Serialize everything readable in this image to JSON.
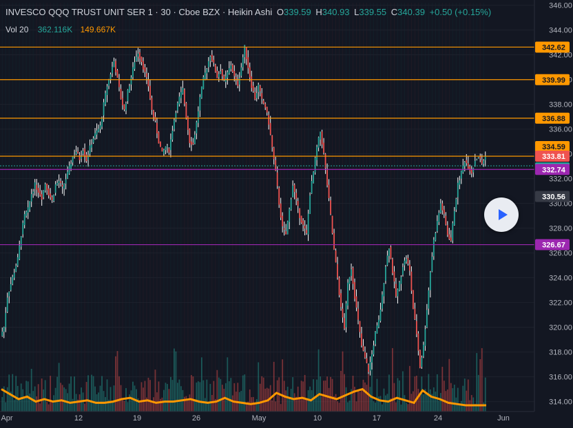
{
  "legend": {
    "symbol": "INVESCO QQQ TRUST UNIT SER 1 · 30 · Cboe BZX · Heikin Ashi",
    "o_label": "O",
    "o_value": "339.59",
    "h_label": "H",
    "h_value": "340.93",
    "l_label": "L",
    "l_value": "339.55",
    "c_label": "C",
    "c_value": "340.39",
    "change": "+0.50 (+0.15%)"
  },
  "volume_legend": {
    "label": "Vol 20",
    "value": "362.116K",
    "ma_value": "149.667K"
  },
  "colors": {
    "background": "#131722",
    "up": "#26a69a",
    "down": "#ef5350",
    "orange_line": "#ff9800",
    "purple_line": "#9c27b0",
    "text": "#d1d4dc"
  },
  "play_button": {
    "icon": "play-icon"
  },
  "chart_data": {
    "type": "candlestick",
    "style": "Heikin Ashi",
    "interval": "30",
    "y_axis": {
      "range": [
        313.2,
        346.2
      ],
      "ticks": [
        "314.00",
        "316.00",
        "318.00",
        "320.00",
        "322.00",
        "324.00",
        "326.00",
        "328.00",
        "330.00",
        "332.00",
        "334.00",
        "336.00",
        "338.00",
        "340.00",
        "342.00",
        "344.00",
        "346.00"
      ]
    },
    "x_axis": {
      "labels": [
        "Apr",
        "12",
        "19",
        "26",
        "May",
        "10",
        "17",
        "24",
        "Jun"
      ]
    },
    "horizontal_lines": [
      {
        "value": 342.62,
        "label": "342.62",
        "color": "#ff9800"
      },
      {
        "value": 339.99,
        "label": "339.99",
        "color": "#ff9800"
      },
      {
        "value": 336.88,
        "label": "336.88",
        "color": "#ff9800"
      },
      {
        "value": 333.81,
        "label": "333.81",
        "color": "#ff9800"
      },
      {
        "value": 332.74,
        "label": "332.74",
        "color": "#9c27b0"
      },
      {
        "value": 326.67,
        "label": "326.67",
        "color": "#9c27b0"
      }
    ],
    "axis_badges": [
      {
        "value": 342.62,
        "label": "342.62",
        "color": "#ff9800"
      },
      {
        "value": 339.99,
        "label": "339.99",
        "color": "#ff9800"
      },
      {
        "value": 336.88,
        "label": "336.88",
        "color": "#ff9800"
      },
      {
        "value": 334.59,
        "label": "334.59",
        "color": "#ff9800"
      },
      {
        "value": 333.81,
        "label": "333.81",
        "color": "#ef5350"
      },
      {
        "value": 333.81,
        "label": "333.81",
        "color": "#26a69a",
        "offset": 1
      },
      {
        "value": 332.74,
        "label": "332.74",
        "color": "#9c27b0"
      },
      {
        "value": 330.56,
        "label": "330.56",
        "color": "#363a45"
      },
      {
        "value": 326.67,
        "label": "326.67",
        "color": "#9c27b0"
      }
    ],
    "last_price": 333.81,
    "price_path": [
      [
        0,
        319.3
      ],
      [
        2,
        320.0
      ],
      [
        4,
        322.5
      ],
      [
        6,
        323.5
      ],
      [
        8,
        324.5
      ],
      [
        10,
        325.5
      ],
      [
        12,
        327.5
      ],
      [
        14,
        329.0
      ],
      [
        16,
        329.5
      ],
      [
        18,
        330.8
      ],
      [
        20,
        331.5
      ],
      [
        22,
        331.0
      ],
      [
        24,
        330.5
      ],
      [
        26,
        331.6
      ],
      [
        28,
        330.8
      ],
      [
        30,
        330.2
      ],
      [
        32,
        331.5
      ],
      [
        34,
        331.8
      ],
      [
        36,
        331.2
      ],
      [
        38,
        332.0
      ],
      [
        40,
        332.8
      ],
      [
        42,
        333.8
      ],
      [
        44,
        334.2
      ],
      [
        46,
        333.6
      ],
      [
        48,
        334.4
      ],
      [
        50,
        333.5
      ],
      [
        52,
        334.5
      ],
      [
        54,
        335.3
      ],
      [
        56,
        335.8
      ],
      [
        58,
        336.2
      ],
      [
        60,
        338.0
      ],
      [
        62,
        339.5
      ],
      [
        64,
        340.5
      ],
      [
        66,
        341.5
      ],
      [
        68,
        340.0
      ],
      [
        70,
        338.5
      ],
      [
        72,
        337.5
      ],
      [
        74,
        339.0
      ],
      [
        76,
        340.2
      ],
      [
        78,
        341.5
      ],
      [
        80,
        342.2
      ],
      [
        82,
        341.5
      ],
      [
        84,
        340.5
      ],
      [
        86,
        339.5
      ],
      [
        88,
        337.5
      ],
      [
        90,
        336.5
      ],
      [
        92,
        335.0
      ],
      [
        94,
        334.0
      ],
      [
        96,
        334.6
      ],
      [
        98,
        334.3
      ],
      [
        100,
        336.0
      ],
      [
        102,
        337.5
      ],
      [
        104,
        338.5
      ],
      [
        106,
        339.2
      ],
      [
        108,
        337.0
      ],
      [
        110,
        335.0
      ],
      [
        112,
        334.8
      ],
      [
        114,
        336.5
      ],
      [
        116,
        338.5
      ],
      [
        118,
        340.0
      ],
      [
        120,
        341.0
      ],
      [
        122,
        342.0
      ],
      [
        124,
        341.2
      ],
      [
        126,
        340.2
      ],
      [
        128,
        340.8
      ],
      [
        130,
        339.8
      ],
      [
        132,
        340.5
      ],
      [
        134,
        341.2
      ],
      [
        136,
        340.2
      ],
      [
        138,
        339.6
      ],
      [
        140,
        341.0
      ],
      [
        142,
        342.6
      ],
      [
        144,
        341.0
      ],
      [
        146,
        339.5
      ],
      [
        148,
        338.5
      ],
      [
        150,
        339.5
      ],
      [
        152,
        338.3
      ],
      [
        154,
        337.8
      ],
      [
        156,
        336.5
      ],
      [
        158,
        334.5
      ],
      [
        160,
        332.5
      ],
      [
        162,
        330.0
      ],
      [
        164,
        328.0
      ],
      [
        166,
        327.5
      ],
      [
        168,
        329.5
      ],
      [
        170,
        331.5
      ],
      [
        172,
        330.2
      ],
      [
        174,
        329.0
      ],
      [
        176,
        328.2
      ],
      [
        178,
        327.5
      ],
      [
        180,
        330.8
      ],
      [
        182,
        332.5
      ],
      [
        184,
        334.5
      ],
      [
        186,
        335.8
      ],
      [
        188,
        334.0
      ],
      [
        190,
        331.5
      ],
      [
        192,
        329.0
      ],
      [
        194,
        326.2
      ],
      [
        196,
        324.0
      ],
      [
        198,
        321.5
      ],
      [
        200,
        320.0
      ],
      [
        202,
        323.5
      ],
      [
        204,
        324.8
      ],
      [
        206,
        322.5
      ],
      [
        208,
        320.5
      ],
      [
        210,
        318.5
      ],
      [
        212,
        317.5
      ],
      [
        214,
        316.5
      ],
      [
        216,
        317.8
      ],
      [
        218,
        319.5
      ],
      [
        220,
        320.5
      ],
      [
        222,
        322.5
      ],
      [
        224,
        325.0
      ],
      [
        226,
        326.5
      ],
      [
        228,
        324.5
      ],
      [
        230,
        322.5
      ],
      [
        232,
        323.5
      ],
      [
        234,
        325.0
      ],
      [
        236,
        325.6
      ],
      [
        238,
        324.5
      ],
      [
        240,
        321.5
      ],
      [
        242,
        319.5
      ],
      [
        244,
        316.8
      ],
      [
        246,
        318.5
      ],
      [
        248,
        321.5
      ],
      [
        250,
        324.5
      ],
      [
        252,
        327.0
      ],
      [
        254,
        328.5
      ],
      [
        256,
        330.0
      ],
      [
        258,
        329.0
      ],
      [
        260,
        327.5
      ],
      [
        262,
        327.0
      ],
      [
        264,
        329.5
      ],
      [
        266,
        331.5
      ],
      [
        268,
        332.5
      ],
      [
        270,
        333.5
      ],
      [
        272,
        333.0
      ],
      [
        274,
        332.5
      ],
      [
        276,
        333.5
      ],
      [
        278,
        333.8
      ],
      [
        280,
        333.2
      ],
      [
        282,
        333.8
      ]
    ],
    "volume_ma": [
      [
        0,
        315.0
      ],
      [
        5,
        314.6
      ],
      [
        10,
        314.2
      ],
      [
        15,
        314.4
      ],
      [
        20,
        314.0
      ],
      [
        25,
        314.2
      ],
      [
        30,
        314.0
      ],
      [
        35,
        314.1
      ],
      [
        40,
        313.9
      ],
      [
        45,
        314.0
      ],
      [
        50,
        314.1
      ],
      [
        55,
        313.9
      ],
      [
        60,
        313.9
      ],
      [
        65,
        314.0
      ],
      [
        70,
        314.2
      ],
      [
        75,
        314.3
      ],
      [
        80,
        314.0
      ],
      [
        85,
        314.1
      ],
      [
        90,
        313.9
      ],
      [
        95,
        314.0
      ],
      [
        100,
        314.0
      ],
      [
        105,
        314.1
      ],
      [
        110,
        314.2
      ],
      [
        115,
        314.0
      ],
      [
        120,
        313.9
      ],
      [
        125,
        314.0
      ],
      [
        130,
        314.3
      ],
      [
        135,
        314.0
      ],
      [
        140,
        313.9
      ],
      [
        145,
        313.8
      ],
      [
        150,
        313.9
      ],
      [
        155,
        314.1
      ],
      [
        160,
        314.7
      ],
      [
        165,
        314.4
      ],
      [
        170,
        314.2
      ],
      [
        175,
        314.3
      ],
      [
        180,
        314.1
      ],
      [
        185,
        314.6
      ],
      [
        190,
        314.4
      ],
      [
        195,
        314.2
      ],
      [
        200,
        314.5
      ],
      [
        205,
        314.8
      ],
      [
        210,
        315.0
      ],
      [
        215,
        314.4
      ],
      [
        220,
        314.1
      ],
      [
        225,
        314.0
      ],
      [
        230,
        314.3
      ],
      [
        235,
        314.1
      ],
      [
        240,
        313.9
      ],
      [
        245,
        314.9
      ],
      [
        250,
        314.4
      ],
      [
        255,
        314.2
      ],
      [
        260,
        313.9
      ],
      [
        265,
        313.8
      ],
      [
        270,
        313.7
      ],
      [
        275,
        313.7
      ],
      [
        282,
        313.7
      ]
    ]
  }
}
